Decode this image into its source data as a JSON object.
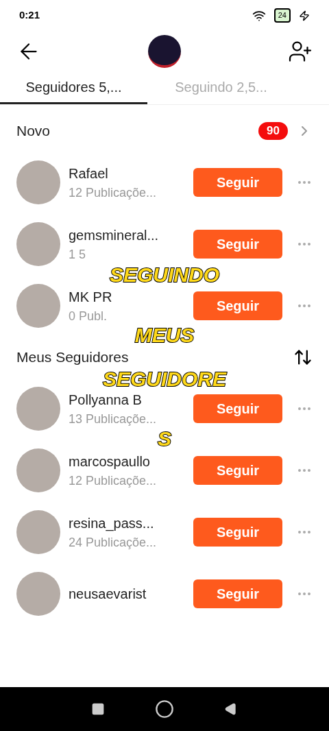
{
  "status_bar": {
    "time": "0:21",
    "battery": "24"
  },
  "tabs": [
    {
      "label": "Seguidores 5,...",
      "selected": true
    },
    {
      "label": "Seguindo 2,5...",
      "selected": false
    }
  ],
  "new_section": {
    "title": "Novo",
    "badge": "90"
  },
  "new_users": [
    {
      "name": "Rafael",
      "posts": "12 Publicaçõe...",
      "button": "Seguir"
    },
    {
      "name": "gemsmineral...",
      "posts": "1 5",
      "button": "Seguir"
    },
    {
      "name": "MK PR",
      "posts": "0 Publ.",
      "button": "Seguir"
    }
  ],
  "followers_section": {
    "title": "Meus Seguidores"
  },
  "followers": [
    {
      "name": "Pollyanna B",
      "posts": "13 Publicaçõe...",
      "button": "Seguir"
    },
    {
      "name": "marcospaullo",
      "posts": "12 Publicaçõe...",
      "button": "Seguir"
    },
    {
      "name": "resina_pass...",
      "posts": "24 Publicaçõe...",
      "button": "Seguir"
    },
    {
      "name": "neusaevarist",
      "button": "Seguir"
    }
  ],
  "caption": [
    "SEGUINDO",
    "MEUS",
    "SEGUIDORE",
    "S"
  ]
}
